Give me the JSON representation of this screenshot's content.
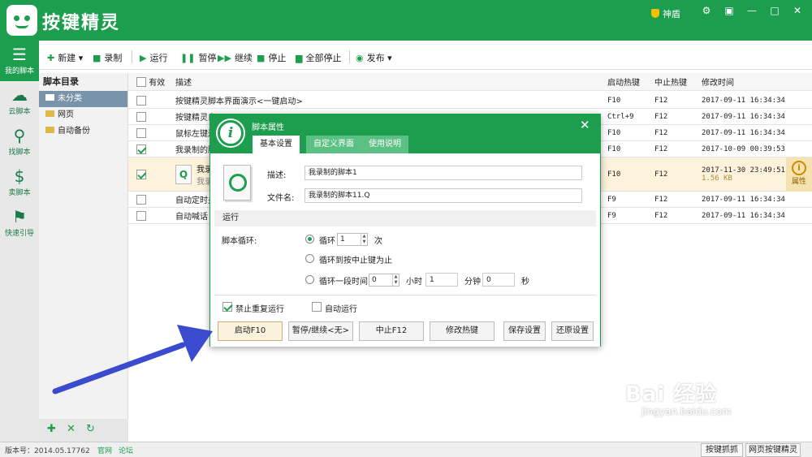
{
  "app": {
    "title": "按键精灵",
    "user": "神盾"
  },
  "sidebar": {
    "items": [
      {
        "label": "我的脚本",
        "icon": "list-icon"
      },
      {
        "label": "云脚本",
        "icon": "cloud-icon"
      },
      {
        "label": "找脚本",
        "icon": "search-icon"
      },
      {
        "label": "卖脚本",
        "icon": "dollar-icon"
      },
      {
        "label": "快速引导",
        "icon": "signpost-icon"
      }
    ]
  },
  "toolbar": {
    "new": "新建",
    "record": "录制",
    "run": "运行",
    "pause": "暂停",
    "resume": "继续",
    "stop": "停止",
    "stop_all": "全部停止",
    "publish": "发布"
  },
  "directory": {
    "title": "脚本目录",
    "items": [
      "未分类",
      "网页",
      "自动备份"
    ]
  },
  "table": {
    "headers": {
      "enabled": "有效",
      "desc": "描述",
      "start_key": "启动热键",
      "stop_key": "中止热键",
      "modified": "修改时间"
    },
    "rows": [
      {
        "checked": false,
        "desc": "按键精灵脚本界面演示<一键启动>",
        "start": "F10",
        "stop": "F12",
        "time": "2017-09-11 16:34:34"
      },
      {
        "checked": false,
        "desc": "按键精灵自",
        "start": "Ctrl+9",
        "stop": "F12",
        "time": "2017-09-11 16:34:34"
      },
      {
        "checked": false,
        "desc": "鼠标左键连",
        "start": "F10",
        "stop": "F12",
        "time": "2017-09-11 16:34:34"
      },
      {
        "checked": true,
        "desc": "我录制的脚",
        "start": "F10",
        "stop": "F12",
        "time": "2017-10-09 00:39:53"
      },
      {
        "checked": true,
        "desc": "我录",
        "desc2": "我录",
        "start": "F10",
        "stop": "F12",
        "time": "2017-11-30 23:49:51",
        "size": "1.56 KB"
      },
      {
        "checked": false,
        "desc": "自动定时关",
        "start": "F9",
        "stop": "F12",
        "time": "2017-09-11 16:34:34"
      },
      {
        "checked": false,
        "desc": "自动喊话",
        "start": "F9",
        "stop": "F12",
        "time": "2017-09-11 16:34:34"
      }
    ],
    "attr_label": "属性"
  },
  "dialog": {
    "title": "脚本属性",
    "tabs": [
      "基本设置",
      "自定义界面",
      "使用说明"
    ],
    "desc_label": "描述:",
    "desc_value": "我录制的脚本1",
    "file_label": "文件名:",
    "file_value": "我录制的脚本11.Q",
    "section": "运行",
    "loop_label": "脚本循环:",
    "opt_loop": "循环",
    "loop_count": "1",
    "times_unit": "次",
    "opt_until_stop": "循环到按中止键为止",
    "opt_period": "循环一段时间",
    "hours": "0",
    "hours_unit": "小时",
    "minutes": "1",
    "minutes_unit": "分钟",
    "seconds": "0",
    "seconds_unit": "秒",
    "no_repeat": "禁止重复运行",
    "auto_run": "自动运行",
    "buttons": {
      "start": "启动F10",
      "pause": "暂停/继续<无>",
      "stop": "中止F12",
      "hotkey": "修改热键",
      "save": "保存设置",
      "restore": "还原设置"
    }
  },
  "footer": {
    "version": "版本号：2014.05.17762",
    "official": "官网",
    "forum": "论坛",
    "capture": "按键抓抓",
    "web": "网页按键精灵"
  },
  "watermark": {
    "main": "Bai 经验",
    "url": "jingyan.baidu.com"
  },
  "colors": {
    "brand": "#1c9e4e",
    "arrow": "#3b4bd0",
    "highlight": "#fdf3dc"
  }
}
